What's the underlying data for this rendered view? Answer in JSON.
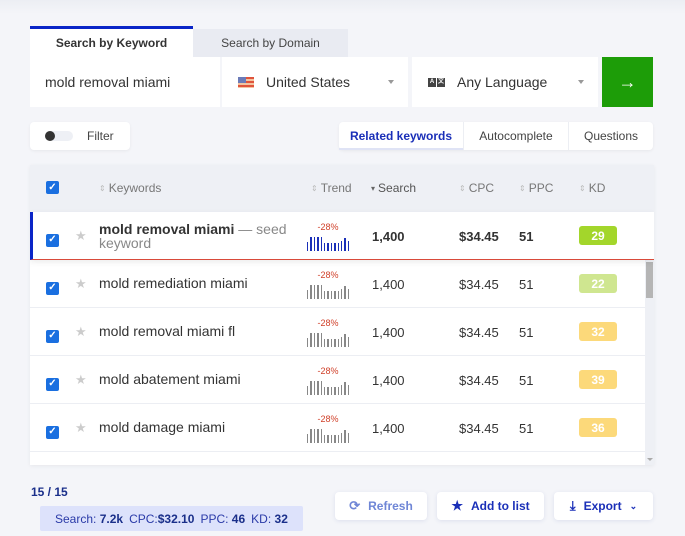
{
  "tabs": [
    {
      "label": "Search by Keyword",
      "active": true
    },
    {
      "label": "Search by Domain",
      "active": false
    }
  ],
  "search": {
    "keyword_value": "mold removal miami",
    "country": {
      "label": "United States",
      "icon": "us-flag-icon"
    },
    "language": {
      "label": "Any Language",
      "icon": "language-icon"
    },
    "go_icon": "→"
  },
  "filter": {
    "label": "Filter",
    "enabled": false
  },
  "modes": [
    {
      "label": "Related keywords",
      "active": true
    },
    {
      "label": "Autocomplete",
      "active": false
    },
    {
      "label": "Questions",
      "active": false
    }
  ],
  "table": {
    "headers": {
      "keywords": "Keywords",
      "trend": "Trend",
      "search": "Search",
      "cpc": "CPC",
      "ppc": "PPC",
      "kd": "KD"
    },
    "sort_icons": {
      "unsorted": "⇕",
      "desc": "▾"
    },
    "seed_suffix": "— seed keyword",
    "trend_bars": [
      0.55,
      0.9,
      0.9,
      0.85,
      0.85,
      0.5,
      0.5,
      0.5,
      0.5,
      0.5,
      0.65,
      0.8,
      0.6
    ],
    "rows": [
      {
        "keyword": "mold removal miami",
        "seed": true,
        "checked": true,
        "trend": "-28%",
        "search": "1,400",
        "cpc": "$34.45",
        "ppc": "51",
        "kd": "29",
        "kd_color": "#a3d62b"
      },
      {
        "keyword": "mold remediation miami",
        "seed": false,
        "checked": true,
        "trend": "-28%",
        "search": "1,400",
        "cpc": "$34.45",
        "ppc": "51",
        "kd": "22",
        "kd_color": "#cfe690"
      },
      {
        "keyword": "mold removal miami fl",
        "seed": false,
        "checked": true,
        "trend": "-28%",
        "search": "1,400",
        "cpc": "$34.45",
        "ppc": "51",
        "kd": "32",
        "kd_color": "#fcd97a"
      },
      {
        "keyword": "mold abatement miami",
        "seed": false,
        "checked": true,
        "trend": "-28%",
        "search": "1,400",
        "cpc": "$34.45",
        "ppc": "51",
        "kd": "39",
        "kd_color": "#fcd97a"
      },
      {
        "keyword": "mold damage miami",
        "seed": false,
        "checked": true,
        "trend": "-28%",
        "search": "1,400",
        "cpc": "$34.45",
        "ppc": "51",
        "kd": "36",
        "kd_color": "#fcd97a"
      }
    ]
  },
  "footer": {
    "count": "15 / 15",
    "summary": {
      "search_label": "Search:",
      "search_value": "7.2k",
      "cpc_label": "CPC:",
      "cpc_value": "$32.10",
      "ppc_label": "PPC:",
      "ppc_value": "46",
      "kd_label": "KD:",
      "kd_value": "32"
    },
    "buttons": {
      "refresh": "Refresh",
      "add_to_list": "Add to list",
      "export": "Export"
    }
  },
  "colors": {
    "accent": "#0a25c7",
    "go_button": "#1d9d08",
    "trend_negative": "#d0412a"
  }
}
